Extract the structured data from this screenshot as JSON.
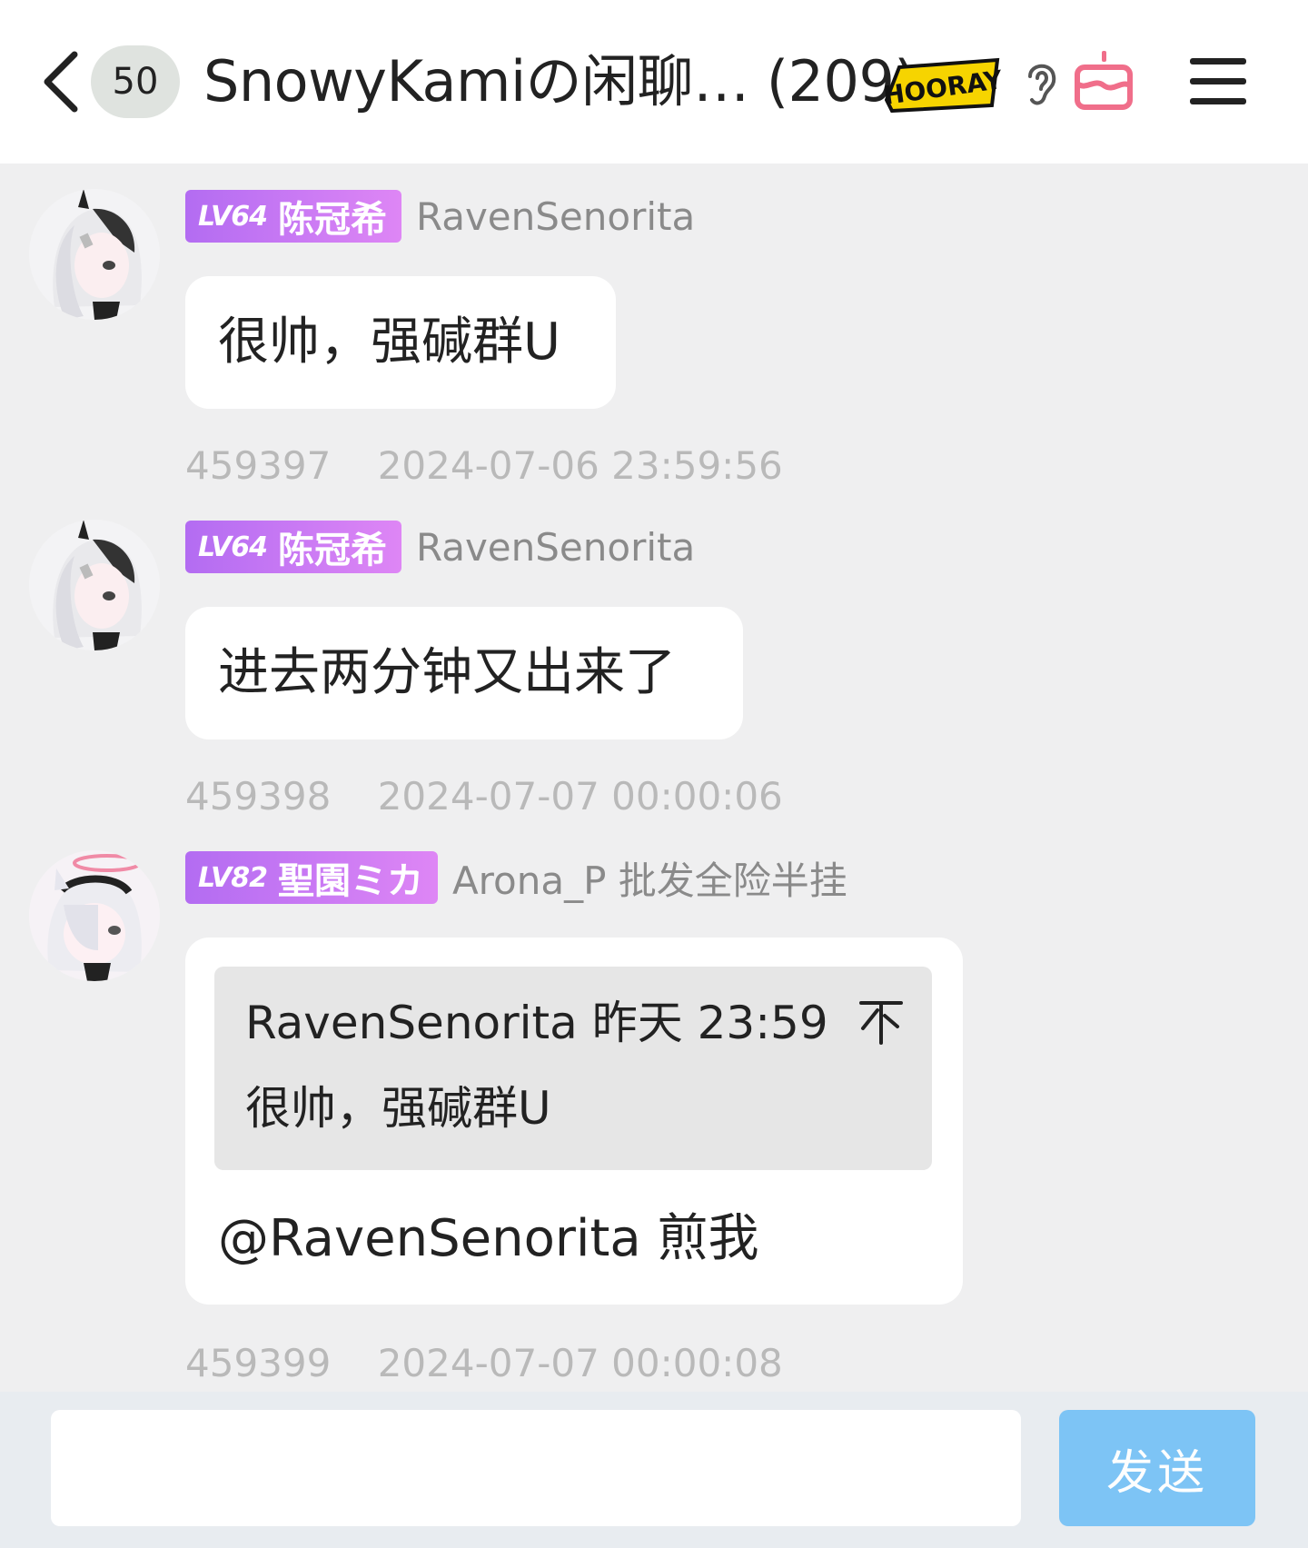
{
  "header": {
    "unread_count": "50",
    "title": "SnowyKamiの闲聊… (209)",
    "hooray_badge_text": "HOORAY",
    "icons": [
      "chevron-left-icon",
      "ear-icon",
      "cake-icon",
      "menu-icon"
    ]
  },
  "messages": [
    {
      "level": "LV64",
      "title_tag": "陈冠希",
      "sender": "RavenSenorita",
      "text": "很帅，强碱群U",
      "id": "459397",
      "timestamp": "2024-07-06 23:59:56"
    },
    {
      "level": "LV64",
      "title_tag": "陈冠希",
      "sender": "RavenSenorita",
      "text": "进去两分钟又出来了",
      "id": "459398",
      "timestamp": "2024-07-07 00:00:06"
    },
    {
      "level": "LV82",
      "title_tag": "聖園ミカ",
      "sender": "Arona_P 批发全险半挂",
      "quote": {
        "header": "RavenSenorita 昨天 23:59",
        "text": "很帅，强碱群U"
      },
      "text": "@RavenSenorita 煎我",
      "id": "459399",
      "timestamp": "2024-07-07 00:00:08"
    }
  ],
  "composer": {
    "input_value": "",
    "send_label": "发送"
  },
  "colors": {
    "background": "#efeff0",
    "level_badge_start": "#b36cf2",
    "level_badge_end": "#de86f5",
    "send_button": "#78c2f6",
    "cake_icon": "#f06e8a"
  }
}
